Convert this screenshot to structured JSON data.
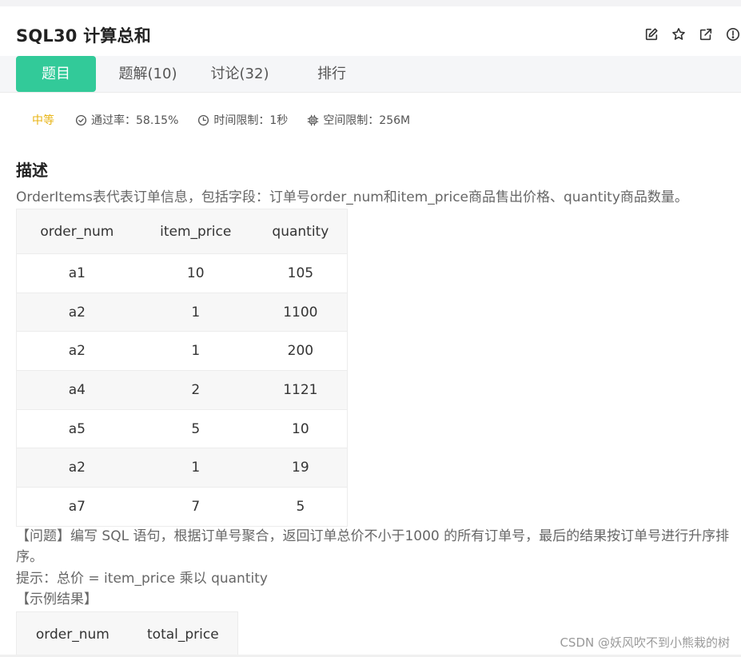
{
  "problem": {
    "title": "SQL30  计算总和"
  },
  "tabs": [
    {
      "label": "题目",
      "active": true
    },
    {
      "label": "题解(10)"
    },
    {
      "label": "讨论(32)"
    },
    {
      "label": "排行"
    }
  ],
  "meta": {
    "difficulty": "中等",
    "pass_rate": "通过率：58.15%",
    "time_limit": "时间限制：1秒",
    "memory_limit": "空间限制：256M"
  },
  "description": {
    "heading": "描述",
    "intro": "OrderItems表代表订单信息，包括字段：订单号order_num和item_price商品售出价格、quantity商品数量。",
    "question": "【问题】编写 SQL 语句，根据订单号聚合，返回订单总价不小于1000 的所有订单号，最后的结果按订单号进行升序排序。",
    "hint": "提示：总价 = item_price 乘以 quantity",
    "example_heading": "【示例结果】"
  },
  "orders_table": {
    "headers": [
      "order_num",
      "item_price",
      "quantity"
    ],
    "rows": [
      [
        "a1",
        "10",
        "105"
      ],
      [
        "a2",
        "1",
        "1100"
      ],
      [
        "a2",
        "1",
        "200"
      ],
      [
        "a4",
        "2",
        "1121"
      ],
      [
        "a5",
        "5",
        "10"
      ],
      [
        "a2",
        "1",
        "19"
      ],
      [
        "a7",
        "7",
        "5"
      ]
    ]
  },
  "result_table": {
    "headers": [
      "order_num",
      "total_price"
    ]
  },
  "watermark": "CSDN @妖风吹不到小熊栽的树",
  "colors": {
    "accent": "#32ca99",
    "difficulty": "#e8b414"
  }
}
